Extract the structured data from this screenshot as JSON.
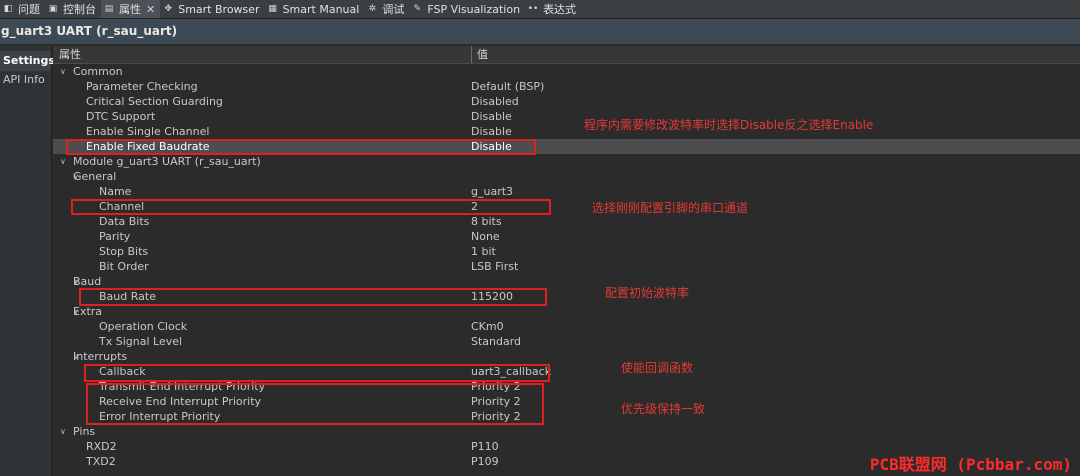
{
  "tabs": [
    {
      "label": "问题",
      "icon": "problems-icon",
      "glyph": "◧"
    },
    {
      "label": "控制台",
      "icon": "console-icon",
      "glyph": "▣"
    },
    {
      "label": "属性",
      "icon": "properties-icon",
      "glyph": "▤",
      "active": true
    },
    {
      "label": "Smart Browser",
      "icon": "smart-browser-icon",
      "glyph": "✥"
    },
    {
      "label": "Smart Manual",
      "icon": "smart-manual-icon",
      "glyph": "▦"
    },
    {
      "label": "调试",
      "icon": "debug-icon",
      "glyph": "✲"
    },
    {
      "label": "FSP Visualization",
      "icon": "fsp-visualization-icon",
      "glyph": "✎"
    },
    {
      "label": "表达式",
      "icon": "expressions-icon",
      "glyph": "••"
    }
  ],
  "title": "g_uart3 UART (r_sau_uart)",
  "leftnav": [
    "Settings",
    "API Info"
  ],
  "table": {
    "col_property": "属性",
    "col_value": "值",
    "rows": [
      {
        "key": "Common",
        "value": "",
        "level": 0,
        "expander": "∨"
      },
      {
        "key": "Parameter Checking",
        "value": "Default (BSP)",
        "level": 2
      },
      {
        "key": "Critical Section Guarding",
        "value": "Disabled",
        "level": 2
      },
      {
        "key": "DTC Support",
        "value": "Disable",
        "level": 2
      },
      {
        "key": "Enable Single Channel",
        "value": "Disable",
        "level": 2
      },
      {
        "key": "Enable Fixed Baudrate",
        "value": "Disable",
        "level": 2,
        "selected": true
      },
      {
        "key": "Module g_uart3 UART (r_sau_uart)",
        "value": "",
        "level": 0,
        "expander": "∨"
      },
      {
        "key": "General",
        "value": "",
        "level": 1,
        "expander": "∨"
      },
      {
        "key": "Name",
        "value": "g_uart3",
        "level": 3
      },
      {
        "key": "Channel",
        "value": "2",
        "level": 3
      },
      {
        "key": "Data Bits",
        "value": "8 bits",
        "level": 3
      },
      {
        "key": "Parity",
        "value": "None",
        "level": 3
      },
      {
        "key": "Stop Bits",
        "value": "1 bit",
        "level": 3
      },
      {
        "key": "Bit Order",
        "value": "LSB First",
        "level": 3
      },
      {
        "key": "Baud",
        "value": "",
        "level": 1,
        "expander": "∨"
      },
      {
        "key": "Baud Rate",
        "value": "115200",
        "level": 3
      },
      {
        "key": "Extra",
        "value": "",
        "level": 1,
        "expander": "∨"
      },
      {
        "key": "Operation Clock",
        "value": "CKm0",
        "level": 3
      },
      {
        "key": "Tx Signal Level",
        "value": "Standard",
        "level": 3
      },
      {
        "key": "Interrupts",
        "value": "",
        "level": 1,
        "expander": "∨"
      },
      {
        "key": "Callback",
        "value": "uart3_callback",
        "level": 3
      },
      {
        "key": "Transmit End Interrupt Priority",
        "value": "Priority 2",
        "level": 3
      },
      {
        "key": "Receive End Interrupt Priority",
        "value": "Priority 2",
        "level": 3
      },
      {
        "key": "Error Interrupt Priority",
        "value": "Priority 2",
        "level": 3
      },
      {
        "key": "Pins",
        "value": "",
        "level": 0,
        "expander": "∨"
      },
      {
        "key": "RXD2",
        "value": "P110",
        "level": 2
      },
      {
        "key": "TXD2",
        "value": "P109",
        "level": 2
      }
    ]
  },
  "annotations": {
    "fixed_baud": "程序内需要修改波特率时选择Disable反之选择Enable",
    "channel": "选择刚刚配置引脚的串口通道",
    "baud": "配置初始波特率",
    "callback": "使能回调函数",
    "priority": "优先级保持一致"
  },
  "watermark": "PCB联盟网 (Pcbbar.com)",
  "colors": {
    "annotation": "#e0201f",
    "selected_row": "#4b4d4f",
    "background": "#2b2b2b"
  }
}
